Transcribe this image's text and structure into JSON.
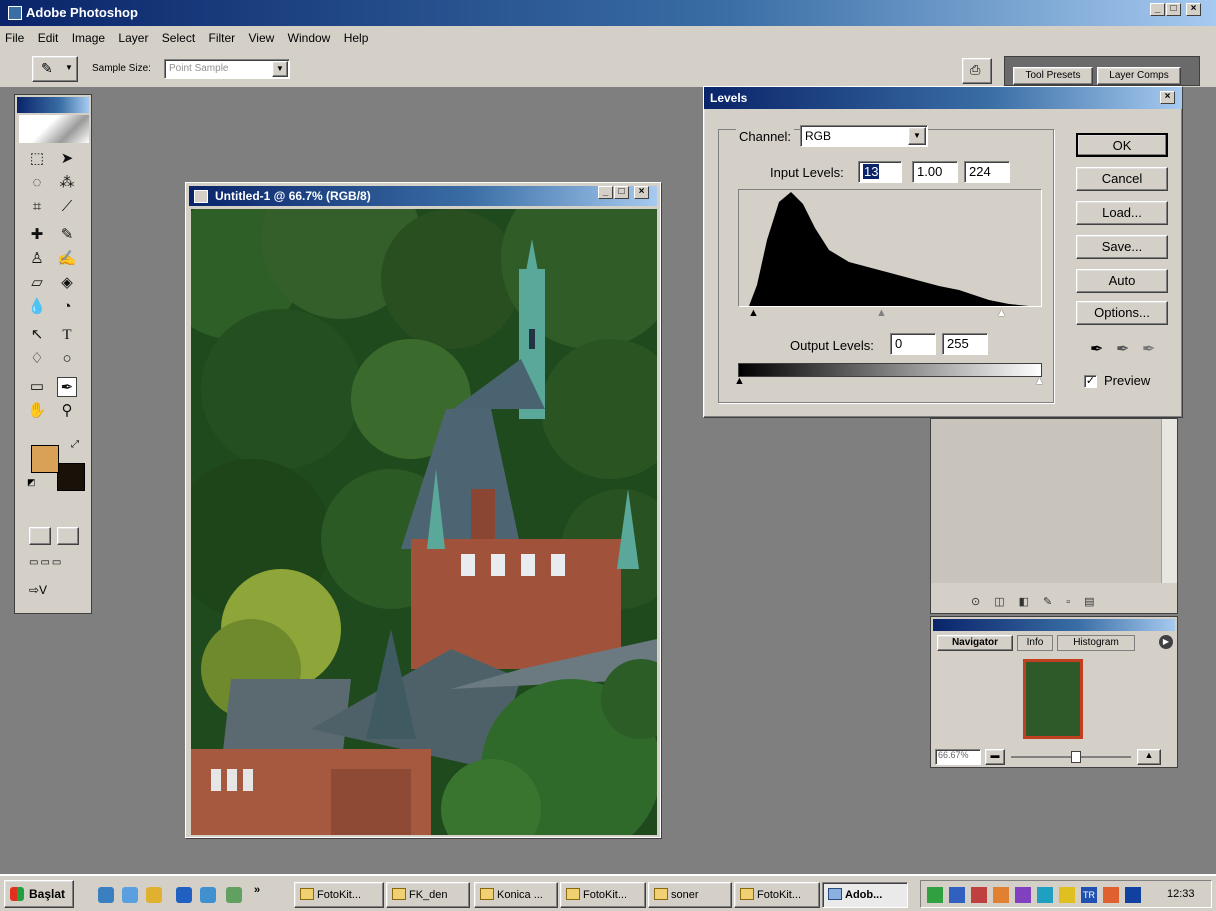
{
  "app": {
    "title": "Adobe Photoshop"
  },
  "menu": [
    "File",
    "Edit",
    "Image",
    "Layer",
    "Select",
    "Filter",
    "View",
    "Window",
    "Help"
  ],
  "options_bar": {
    "sample_size_label": "Sample Size:",
    "sample_size_value": "Point Sample",
    "tabs": [
      "Tool Presets",
      "Layer Comps"
    ]
  },
  "document": {
    "title": "Untitled-1 @ 66.7% (RGB/8)"
  },
  "levels": {
    "title": "Levels",
    "channel_label": "Channel:",
    "channel_value": "RGB",
    "input_levels_label": "Input Levels:",
    "input_black": "13",
    "input_gamma": "1.00",
    "input_white": "224",
    "output_levels_label": "Output Levels:",
    "output_black": "0",
    "output_white": "255",
    "buttons": {
      "ok": "OK",
      "cancel": "Cancel",
      "load": "Load...",
      "save": "Save...",
      "auto": "Auto",
      "options": "Options..."
    },
    "preview_label": "Preview",
    "preview_checked": true,
    "histogram_color": "#000000"
  },
  "navigator": {
    "tabs": [
      "Navigator",
      "Info",
      "Histogram"
    ],
    "zoom": "66.67%"
  },
  "taskbar": {
    "start_label": "Başlat",
    "tasks": [
      "FotoKit...",
      "FK_den",
      "Konica ...",
      "FotoKit...",
      "soner",
      "FotoKit...",
      "Adob..."
    ],
    "clock": "12:33"
  },
  "colors": {
    "foreground": "#d9a058",
    "background": "#1a1208",
    "titlebar": "#0a246a"
  }
}
